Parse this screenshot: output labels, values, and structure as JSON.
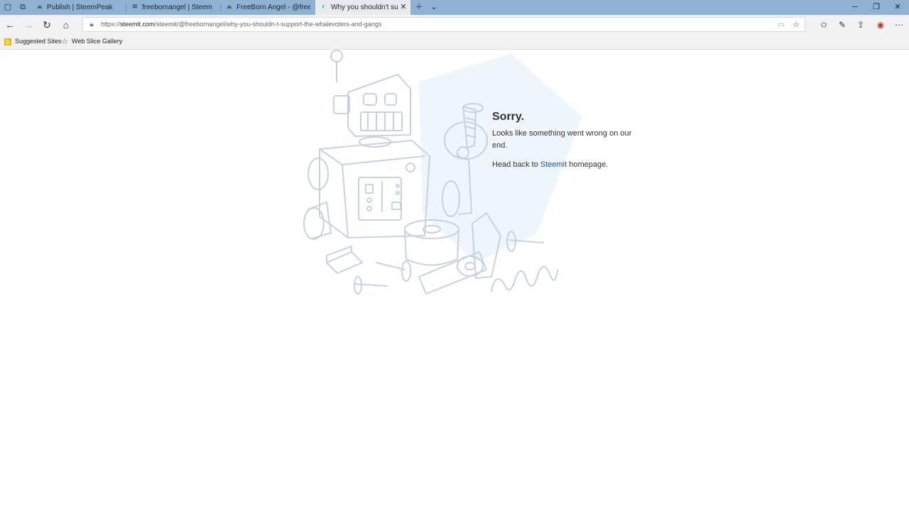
{
  "tabs": [
    {
      "label": "Publish | SteemPeak",
      "icon": "steempeak-icon",
      "active": false
    },
    {
      "label": "freebornangel | Steem",
      "icon": "steem-icon",
      "active": false
    },
    {
      "label": "FreeBorn Angel - @freeborn",
      "icon": "steempeak-icon",
      "active": false
    },
    {
      "label": "Why you shouldn't support",
      "icon": "steemit-icon",
      "active": true
    }
  ],
  "address_bar": {
    "url_prefix": "https://",
    "url_domain": "steemit.com",
    "url_path": "/steemit/@freebornangel/why-you-shouldn-t-support-the-whalevoters-and-gangs"
  },
  "favorites": [
    {
      "label": "Suggested Sites",
      "icon": "bing-icon"
    },
    {
      "label": "Web Slice Gallery",
      "icon": "star-icon"
    }
  ],
  "error_page": {
    "title": "Sorry.",
    "message": "Looks like something went wrong on our end.",
    "home_prefix": "Head back to ",
    "home_link": "Steemit",
    "home_suffix": " homepage."
  },
  "colors": {
    "title_bar": "#8fb2d3",
    "link": "#1a5099",
    "illustration": "#c8d1e0"
  }
}
